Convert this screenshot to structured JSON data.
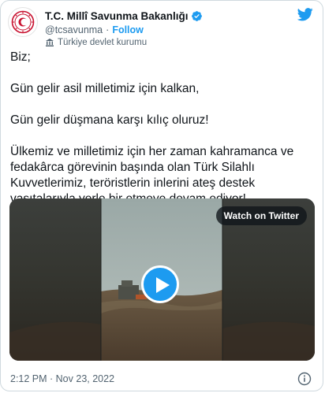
{
  "author": {
    "display_name": "T.C. Millî Savunma Bakanlığı",
    "handle": "@tcsavunma",
    "follow_label": "Follow",
    "separator": "·",
    "account_label": "Türkiye devlet kurumu"
  },
  "tweet": {
    "paragraphs": [
      "Biz;",
      "Gün gelir asil milletimiz için kalkan,",
      "Gün gelir düşmana karşı kılıç oluruz!",
      "Ülkemiz ve milletimiz için her zaman kahramanca ve fedakârca görevinin başında olan Türk Silahlı Kuvvetlerimiz, teröristlerin inlerini ateş destek vasıtalarıyla yerle bir etmeye devam ediyor!"
    ]
  },
  "media": {
    "watch_label": "Watch on Twitter"
  },
  "footer": {
    "timestamp": "2:12 PM · Nov 23, 2022"
  },
  "colors": {
    "accent": "#1d9bf0",
    "text": "#0f1419",
    "secondary": "#536471"
  },
  "icons": [
    "verified-badge-icon",
    "government-label-icon",
    "twitter-logo-icon",
    "play-icon",
    "info-icon"
  ]
}
